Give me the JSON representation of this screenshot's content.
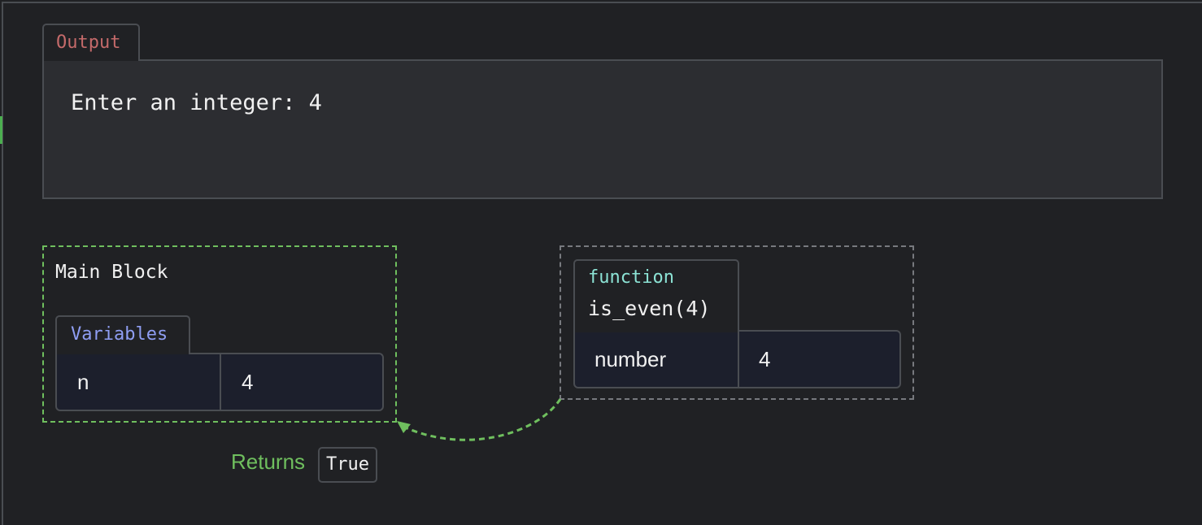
{
  "output": {
    "tab_label": "Output",
    "text": "Enter an integer: 4"
  },
  "main_block": {
    "title": "Main Block",
    "variables_tab": "Variables",
    "variables": [
      {
        "name": "n",
        "value": "4"
      }
    ]
  },
  "function_frame": {
    "kind": "function",
    "signature": "is_even(4)",
    "params": [
      {
        "name": "number",
        "value": "4"
      }
    ]
  },
  "return_info": {
    "label": "Returns",
    "value": "True"
  },
  "colors": {
    "background": "#202124",
    "active_frame_border": "#6fbf5e",
    "inactive_frame_border": "#77797e",
    "output_tab_text": "#c46a6a",
    "variables_tab_text": "#8f9ef3",
    "function_kind_text": "#8ce3d5",
    "return_arrow": "#6fbf5e"
  }
}
